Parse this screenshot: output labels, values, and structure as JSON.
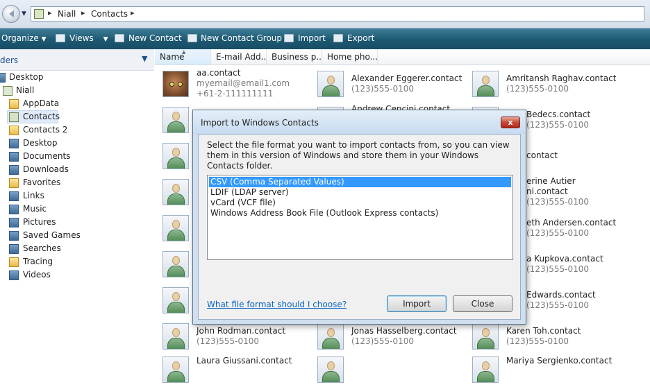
{
  "address": {
    "crumbs": [
      "Niall",
      "Contacts"
    ]
  },
  "commands": {
    "organize": "Organize",
    "views": "Views",
    "new_contact": "New Contact",
    "new_group": "New Contact Group",
    "import": "Import",
    "export": "Export"
  },
  "left": {
    "header": "ders",
    "items": [
      {
        "label": "Desktop",
        "icon": "desktop-icon"
      },
      {
        "label": "Niall",
        "icon": "user-folder-icon"
      },
      {
        "label": "AppData",
        "icon": "folder-icon"
      },
      {
        "label": "Contacts",
        "icon": "contacts-folder-icon",
        "selected": true
      },
      {
        "label": "Contacts 2",
        "icon": "folder-icon"
      },
      {
        "label": "Desktop",
        "icon": "desktop-folder-icon"
      },
      {
        "label": "Documents",
        "icon": "documents-folder-icon"
      },
      {
        "label": "Downloads",
        "icon": "downloads-folder-icon"
      },
      {
        "label": "Favorites",
        "icon": "favorites-folder-icon"
      },
      {
        "label": "Links",
        "icon": "links-folder-icon"
      },
      {
        "label": "Music",
        "icon": "music-folder-icon"
      },
      {
        "label": "Pictures",
        "icon": "pictures-folder-icon"
      },
      {
        "label": "Saved Games",
        "icon": "saved-games-folder-icon"
      },
      {
        "label": "Searches",
        "icon": "searches-folder-icon"
      },
      {
        "label": "Tracing",
        "icon": "folder-icon"
      },
      {
        "label": "Videos",
        "icon": "videos-folder-icon"
      }
    ]
  },
  "columns": [
    "Name",
    "E-mail Add...",
    "Business p...",
    "Home pho..."
  ],
  "contacts": {
    "aa": {
      "name": "aa.contact",
      "email": "myemail@email1.com",
      "phone": "+61-2-111111111"
    },
    "alexander": {
      "name": "Alexander Eggerer.contact",
      "phone": "(123)555-0100"
    },
    "amritansh": {
      "name": "Amritansh Raghav.contact",
      "phone": "(123)555-0100"
    },
    "andrew": {
      "name": "Andrew Cencini.contact"
    },
    "bedecs": {
      "name": "Bedecs.contact",
      "phone": "(123)555-0100"
    },
    "c3": {
      "name": "contact"
    },
    "autier": {
      "name": "erine Autier",
      "line2": "ni.contact",
      "phone": "(123)555-0100"
    },
    "andersen": {
      "name": "eth Andersen.contact",
      "phone": "(123)555-0100"
    },
    "kupkova": {
      "name": "a Kupkova.contact",
      "phone": "(123)555-0100"
    },
    "edwards": {
      "name": "Edwards.contact",
      "phone": "(123)555-0100"
    },
    "rodman": {
      "name": "John Rodman.contact",
      "phone": "(123)555-0100"
    },
    "hasselberg": {
      "name": "Jonas Hasselberg.contact",
      "phone": "(123)555-0100"
    },
    "toh": {
      "name": "Karen Toh.contact",
      "phone": "(123)555-0100"
    },
    "giussani": {
      "name": "Laura Giussani.contact"
    },
    "sergienko": {
      "name": "Mariya Sergienko.contact"
    }
  },
  "dialog": {
    "title": "Import to Windows Contacts",
    "close_glyph": "x",
    "description": "Select the file format you want to import contacts from, so you can view them in this version of Windows and store them in your Windows Contacts folder.",
    "options": [
      "CSV (Comma Separated Values)",
      "LDIF (LDAP server)",
      "vCard (VCF file)",
      "Windows Address Book File (Outlook Express contacts)"
    ],
    "selected_index": 0,
    "help_link": "What file format should I choose?",
    "import_label": "Import",
    "close_label": "Close"
  }
}
